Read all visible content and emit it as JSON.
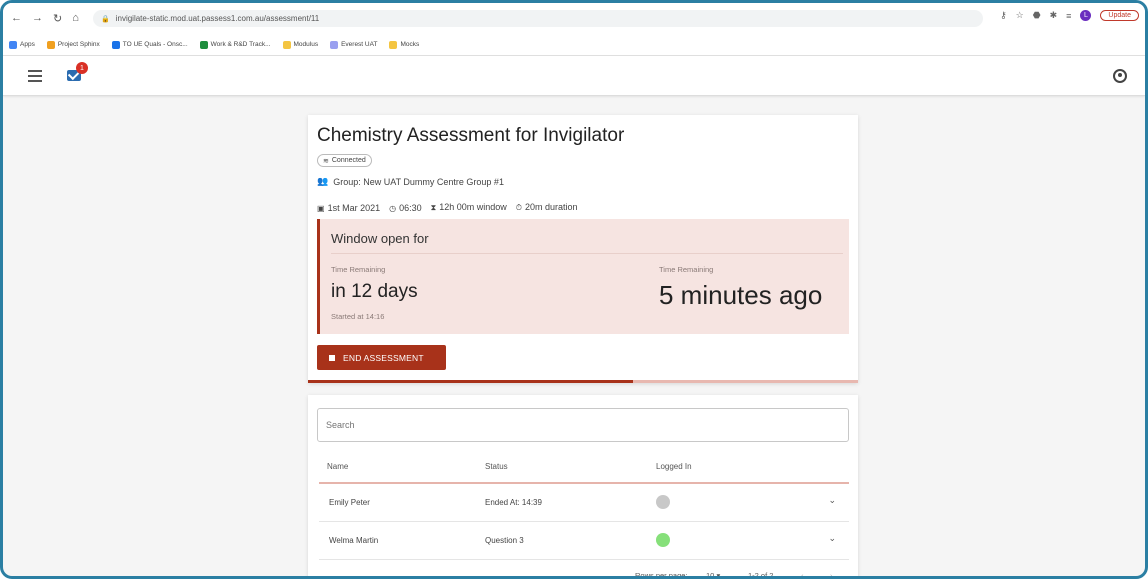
{
  "browser": {
    "url": "invigilate-static.mod.uat.passess1.com.au/assessment/11",
    "update_label": "Update",
    "profile_initial": "L"
  },
  "bookmarks": [
    {
      "label": "Apps",
      "color": "#4285f4"
    },
    {
      "label": "Project Sphinx",
      "color": "#f0a020"
    },
    {
      "label": "TO UE Quals - Onsc...",
      "color": "#1a73e8"
    },
    {
      "label": "Work & R&D Track...",
      "color": "#1e8e3e"
    },
    {
      "label": "Modulus",
      "color": "#f4c542"
    },
    {
      "label": "Everest UAT",
      "color": "#9aa0f0"
    },
    {
      "label": "Mocks",
      "color": "#f4c542"
    }
  ],
  "header": {
    "mail_count": "1"
  },
  "assessment": {
    "title": "Chemistry Assessment for Invigilator",
    "connection_status": "Connected",
    "group": "Group: New UAT Dummy Centre Group #1",
    "date": "1st Mar 2021",
    "time": "06:30",
    "window": "12h 00m window",
    "duration": "20m duration",
    "window_title": "Window open for",
    "left_label": "Time Remaining",
    "left_value": "in 12 days",
    "started": "Started at 14:16",
    "right_label": "Time Remaining",
    "right_value": "5 minutes ago",
    "end_button": "END ASSESSMENT",
    "progress_fraction": 0.59
  },
  "table": {
    "search_placeholder": "Search",
    "columns": [
      "Name",
      "Status",
      "Logged In"
    ],
    "rows": [
      {
        "name": "Emily Peter",
        "status": "Ended At: 14:39",
        "logged_in_color": "#c8c8c8"
      },
      {
        "name": "Welma Martin",
        "status": "Question 3",
        "logged_in_color": "#86e07a"
      }
    ],
    "rows_per_page_label": "Rows per page:",
    "rows_per_page": "10",
    "range": "1-2 of 2"
  }
}
